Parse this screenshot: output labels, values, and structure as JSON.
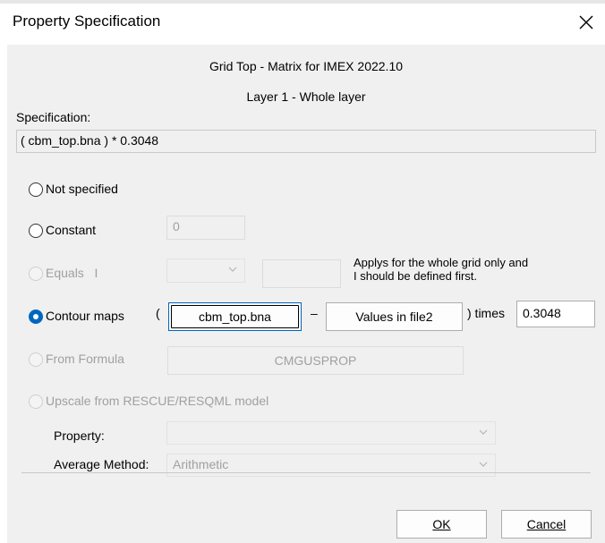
{
  "window": {
    "title": "Property Specification"
  },
  "header": {
    "line1": "Grid Top - Matrix for IMEX 2022.10",
    "line2": "Layer 1 - Whole layer"
  },
  "specification": {
    "label": "Specification:",
    "value": "( cbm_top.bna ) * 0.3048"
  },
  "options": {
    "not_specified": "Not specified",
    "constant": {
      "label": "Constant",
      "value": "0"
    },
    "equals": {
      "label": "Equals",
      "suffix": "I",
      "note_line1": "Applys for the whole grid only and",
      "note_line2": "I should be defined first."
    },
    "contour_maps": {
      "label": "Contour maps",
      "open_paren": "(",
      "file1": "cbm_top.bna",
      "minus": "–",
      "file2": "Values in file2",
      "close_times": ") times",
      "multiplier": "0.3048"
    },
    "from_formula": {
      "label": "From Formula",
      "button": "CMGUSPROP"
    },
    "upscale": {
      "label": "Upscale from RESCUE/RESQML model",
      "property_label": "Property:",
      "property_value": "",
      "average_label": "Average Method:",
      "average_value": "Arithmetic"
    }
  },
  "buttons": {
    "ok": "OK",
    "cancel": "Cancel"
  },
  "colors": {
    "accent": "#0067c0",
    "dialog_bg": "#f0f0f0"
  }
}
